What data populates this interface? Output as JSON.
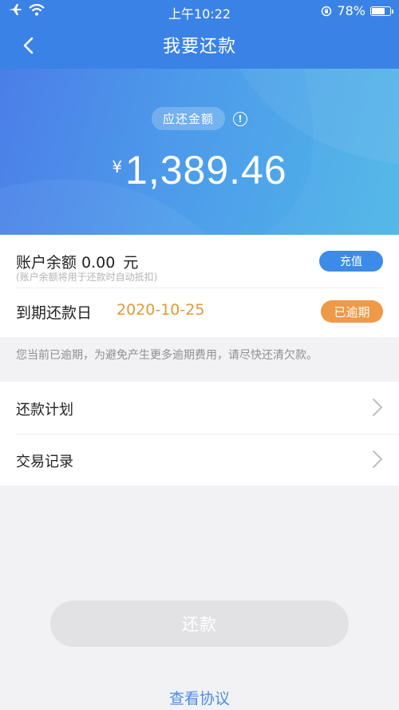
{
  "status_bar": {
    "time": "上午10:22",
    "battery_percent": "78%",
    "battery_level": 0.78,
    "icons": [
      "airplane-icon",
      "wifi-icon",
      "rotation-lock-icon",
      "battery-icon"
    ]
  },
  "nav": {
    "title": "我要还款",
    "back_icon": "chevron-left-icon"
  },
  "hero": {
    "due_label": "应还金额",
    "info_glyph": "!",
    "currency": "¥",
    "amount": "1,389.46"
  },
  "account": {
    "balance_label": "账户余额",
    "balance_value": "0.00",
    "balance_unit": "元",
    "balance_note": "(账户余额将用于还款时自动抵扣)",
    "recharge_label": "充值",
    "due_date_label": "到期还款日",
    "due_date_value": "2020-10-25",
    "overdue_badge": "已逾期"
  },
  "warning_text": "您当前已逾期，为避免产生更多逾期费用，请尽快还清欠款。",
  "menu": [
    {
      "label": "还款计划"
    },
    {
      "label": "交易记录"
    }
  ],
  "actions": {
    "repay_label": "还款",
    "agreement_label": "查看协议"
  },
  "colors": {
    "nav_bg": "#3b82e6",
    "hero_gradient_start": "#4b7ee8",
    "hero_gradient_end": "#4fb6e8",
    "accent_blue": "#3d8be8",
    "overdue_orange": "#ee9a48",
    "date_orange": "#e09a3a",
    "disabled_button": "#e2e2e4"
  }
}
